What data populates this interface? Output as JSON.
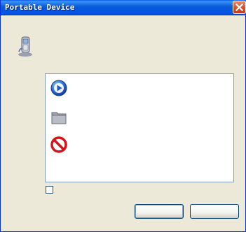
{
  "window": {
    "title": "Portable Device"
  },
  "icons": {
    "device": "portable-device-icon",
    "close": "close-icon",
    "items": [
      "media-player-icon",
      "folder-icon",
      "no-action-icon"
    ]
  },
  "colors": {
    "titlebar": "#0a5fd8",
    "close_button": "#d9532f",
    "dialog_background": "#ece9d8"
  }
}
